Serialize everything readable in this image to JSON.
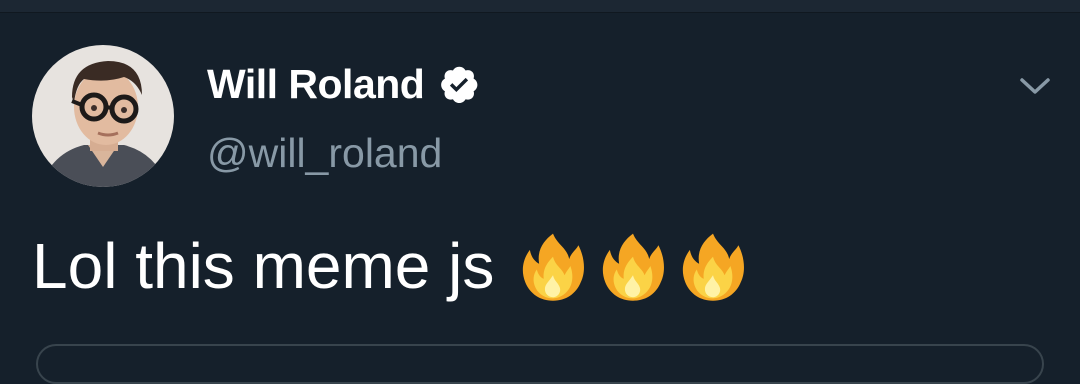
{
  "tweet": {
    "author": {
      "display_name": "Will Roland",
      "handle": "@will_roland",
      "verified": true
    },
    "text": "Lol this meme js",
    "emojis": [
      "fire-emoji",
      "fire-emoji",
      "fire-emoji"
    ],
    "menu_icon": "chevron-down-icon"
  },
  "colors": {
    "background": "#15202b",
    "primary_text": "#ffffff",
    "secondary_text": "#8899a6",
    "verified_badge": "#ffffff",
    "card_border": "#38444d"
  }
}
